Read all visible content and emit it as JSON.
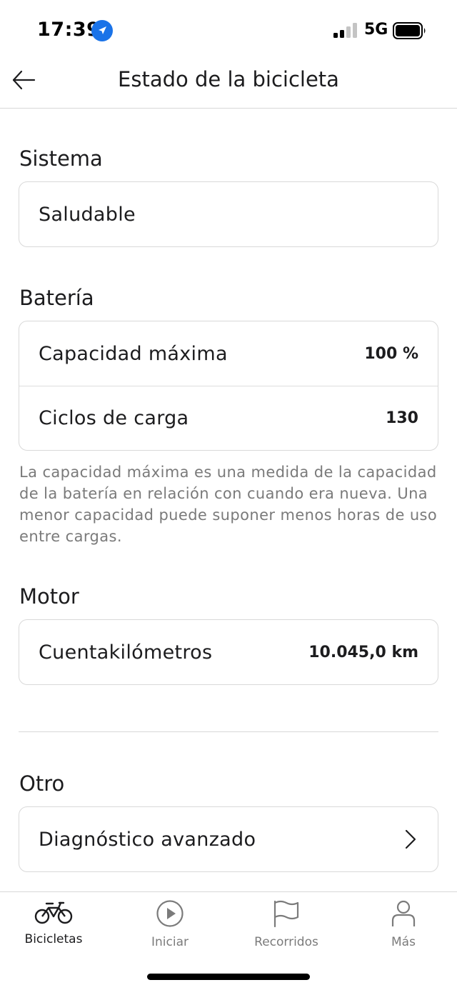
{
  "status_bar": {
    "time": "17:39",
    "network": "5G",
    "icons": [
      "location-icon",
      "signal-icon",
      "battery-icon"
    ]
  },
  "nav": {
    "title": "Estado de la bicicleta",
    "back_icon": "arrow-left-icon"
  },
  "sections": {
    "system": {
      "title": "Sistema",
      "status": "Saludable"
    },
    "battery": {
      "title": "Batería",
      "rows": [
        {
          "label": "Capacidad máxima",
          "value": "100 %"
        },
        {
          "label": "Ciclos de carga",
          "value": "130"
        }
      ],
      "note": "La capacidad máxima es una medida de la capacidad de la batería en relación con cuando era nueva. Una menor capacidad puede suponer menos horas de uso entre cargas."
    },
    "motor": {
      "title": "Motor",
      "rows": [
        {
          "label": "Cuentakilómetros",
          "value": "10.045,0 km"
        }
      ]
    },
    "other": {
      "title": "Otro",
      "rows": [
        {
          "label": "Diagnóstico avanzado",
          "icon": "chevron-right-icon"
        }
      ]
    }
  },
  "tab_bar": {
    "tabs": [
      {
        "label": "Bicicletas",
        "icon": "bicycle-icon",
        "active": true
      },
      {
        "label": "Iniciar",
        "icon": "play-icon",
        "active": false
      },
      {
        "label": "Recorridos",
        "icon": "flag-icon",
        "active": false
      },
      {
        "label": "Más",
        "icon": "person-icon",
        "active": false
      }
    ]
  },
  "colors": {
    "accent_location": "#1a73e8",
    "text_primary": "#1c1c1e",
    "text_secondary": "#7a7a7a",
    "border": "#d9d9d9"
  }
}
